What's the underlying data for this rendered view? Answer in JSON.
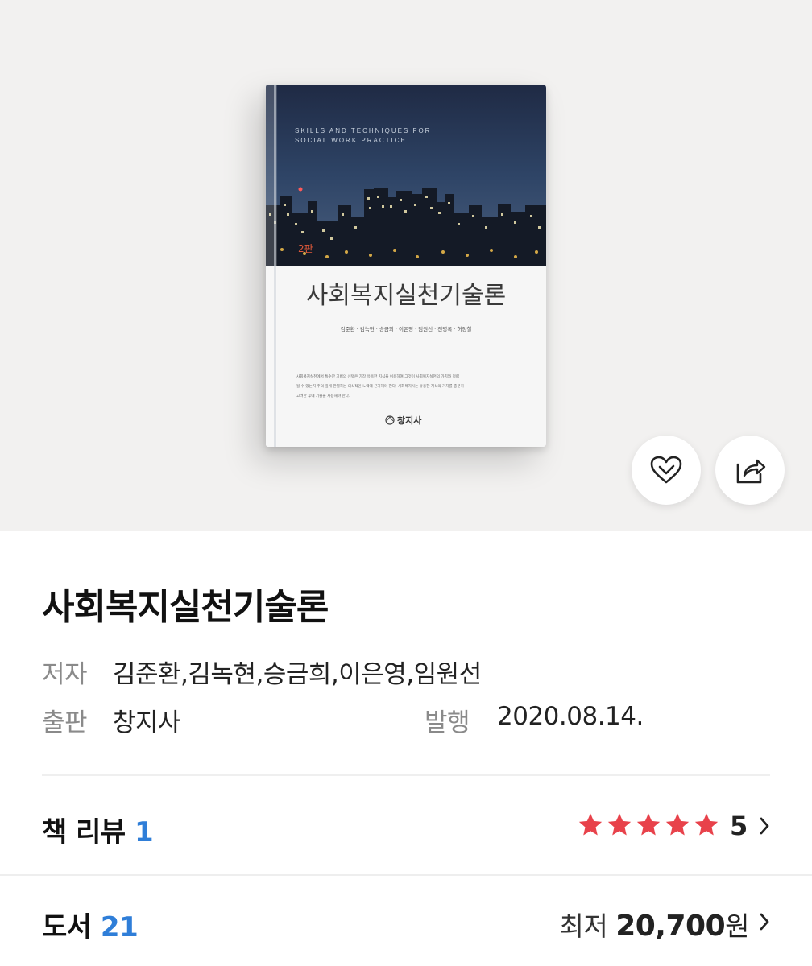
{
  "book_cover": {
    "subtitle_en_line1": "SKILLS AND TECHNIQUES FOR",
    "subtitle_en_line2": "SOCIAL WORK PRACTICE",
    "edition": "2판",
    "title": "사회복지실천기술론",
    "authors_line": "김준환 · 김녹현 · 승금희 · 이은영 · 임원선 · 전명록 · 허정철",
    "blurb_line1": "사회복지실천에서 특수한 기법의 선택은 가장 유용한 지식을 이용하여 그것이 사회복지실천의 가치와 정립",
    "blurb_line2": "될 수 있는지 주의 깊게 판별하는 의식적인 노력에 근거해야 한다. 사회복지사는 유용한 지식의 가치를 충분히",
    "blurb_line3": "고려한 후에 기술을 사용해야 한다.",
    "publisher": "창지사"
  },
  "actions": {
    "like_icon": "heart-outline-icon",
    "share_icon": "share-icon"
  },
  "info": {
    "title": "사회복지실천기술론",
    "author_label": "저자",
    "author_value": "김준환,김녹현,승금희,이은영,임원선",
    "publisher_label": "출판",
    "publisher_value": "창지사",
    "date_label": "발행",
    "date_value": "2020.08.14."
  },
  "review": {
    "label": "책 리뷰",
    "count": "1",
    "stars": 5,
    "rating": "5",
    "star_color": "#e8424b"
  },
  "stock": {
    "label": "도서",
    "count": "21",
    "price_label": "최저",
    "price_value": "20,700",
    "price_unit": "원"
  },
  "colors": {
    "accent_blue": "#2f7ed8"
  }
}
